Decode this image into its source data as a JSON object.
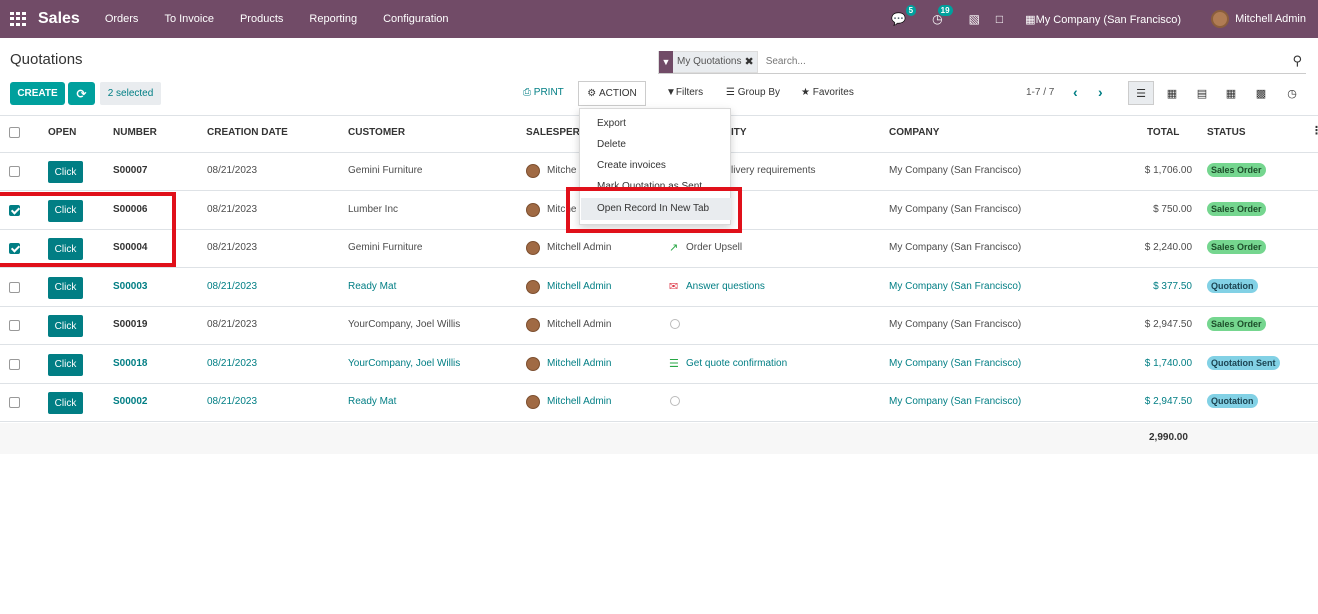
{
  "nav": {
    "brand": "Sales",
    "items": [
      "Orders",
      "To Invoice",
      "Products",
      "Reporting",
      "Configuration"
    ],
    "messages_badge": "5",
    "activities_badge": "19",
    "company": "My Company (San Francisco)",
    "user": "Mitchell Admin"
  },
  "control": {
    "title": "Quotations",
    "create_label": "CREATE",
    "refresh_icon": "sync-icon",
    "selected_label": "2 selected",
    "facet_label": "My Quotations",
    "search_placeholder": "Search...",
    "print_label": "PRINT",
    "action_label": "ACTION",
    "filters_label": "Filters",
    "groupby_label": "Group By",
    "favorites_label": "Favorites",
    "pager": "1-7 / 7"
  },
  "columns": {
    "open": "OPEN",
    "number": "NUMBER",
    "date": "CREATION DATE",
    "customer": "CUSTOMER",
    "salesperson": "SALESPER",
    "activity": "ITY",
    "company": "COMPANY",
    "total": "TOTAL",
    "status": "STATUS"
  },
  "rows": [
    {
      "checked": false,
      "btn": "Click",
      "number": "S00007",
      "date": "08/21/2023",
      "customer": "Gemini Furniture",
      "salesperson": "Mitche",
      "activity": "livery requirements",
      "company": "My Company (San Francisco)",
      "total": "$ 1,706.00",
      "status": "Sales Order"
    },
    {
      "checked": true,
      "btn": "Click",
      "number": "S00006",
      "date": "08/21/2023",
      "customer": "Lumber Inc",
      "salesperson": "Mitche",
      "activity": "",
      "company": "My Company (San Francisco)",
      "total": "$ 750.00",
      "status": "Sales Order"
    },
    {
      "checked": true,
      "btn": "Click",
      "number": "S00004",
      "date": "08/21/2023",
      "customer": "Gemini Furniture",
      "salesperson": "Mitchell Admin",
      "activity": "Order Upsell",
      "company": "My Company (San Francisco)",
      "total": "$ 2,240.00",
      "status": "Sales Order"
    },
    {
      "checked": false,
      "btn": "Click",
      "number": "S00003",
      "date": "08/21/2023",
      "customer": "Ready Mat",
      "salesperson": "Mitchell Admin",
      "activity": "Answer questions",
      "company": "My Company (San Francisco)",
      "total": "$ 377.50",
      "status": "Quotation"
    },
    {
      "checked": false,
      "btn": "Click",
      "number": "S00019",
      "date": "08/21/2023",
      "customer": "YourCompany, Joel Willis",
      "salesperson": "Mitchell Admin",
      "activity": "",
      "company": "My Company (San Francisco)",
      "total": "$ 2,947.50",
      "status": "Sales Order"
    },
    {
      "checked": false,
      "btn": "Click",
      "number": "S00018",
      "date": "08/21/2023",
      "customer": "YourCompany, Joel Willis",
      "salesperson": "Mitchell Admin",
      "activity": "Get quote confirmation",
      "company": "My Company (San Francisco)",
      "total": "$ 1,740.00",
      "status": "Quotation Sent"
    },
    {
      "checked": false,
      "btn": "Click",
      "number": "S00002",
      "date": "08/21/2023",
      "customer": "Ready Mat",
      "salesperson": "Mitchell Admin",
      "activity": "",
      "company": "My Company (San Francisco)",
      "total": "$ 2,947.50",
      "status": "Quotation"
    }
  ],
  "footer_total": "2,990.00",
  "action_menu": [
    "Export",
    "Delete",
    "Create invoices",
    "Mark Quotation as Sent",
    "Open Record In New Tab"
  ],
  "colors": {
    "brand": "#714b67",
    "accent": "#017e84",
    "highlight": "#e0101a"
  }
}
